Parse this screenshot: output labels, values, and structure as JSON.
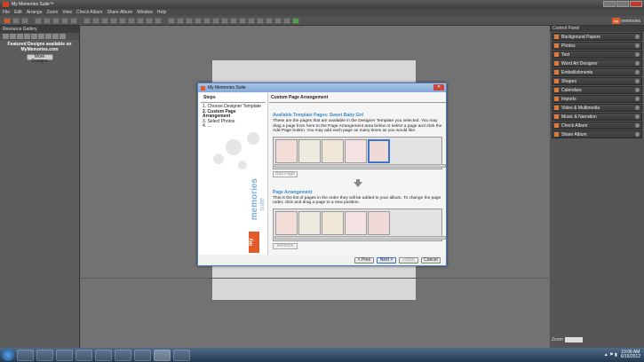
{
  "app": {
    "title": "My Memories Suite™",
    "brand_box": "my",
    "brand_text": "memories"
  },
  "menu": [
    "File",
    "Edit",
    "Arrange",
    "Zoom",
    "View",
    "Check Album",
    "Share Album",
    "Window",
    "Help"
  ],
  "left_panel": {
    "title": "Resource Gallery",
    "message_line1": "Featured Designs available on",
    "message_line2": "MyMemories.com",
    "more_button": "More Designs"
  },
  "right_panel": {
    "title": "Control Panel",
    "items": [
      "Background Papers",
      "Photos",
      "Text",
      "Word Art Designer",
      "Embellishments",
      "Shapes",
      "Calendars",
      "Imports",
      "Video & Multimedia",
      "Music & Narration",
      "Check Album",
      "Share Album"
    ],
    "zoom_label": "Zoom"
  },
  "dialog": {
    "title": "My Memories Suite",
    "steps_header": "Steps",
    "steps": [
      "1. Choose Designer Template",
      "2. Custom Page Arrangement",
      "3. Select Photos",
      "4. ..."
    ],
    "section_header": "Custom Page Arrangement",
    "available_heading": "Available Template Pages: Sweet Baby Girl",
    "available_text": "These are the pages that are available in the Designer Template you selected. You may drag a page from here to the Page Arrangement area below or select a page and click the Add Page button. You may add each page as many times as you would like.",
    "add_page": "Add Page",
    "arrangement_heading": "Page Arrangement",
    "arrangement_text": "This is the list of pages in the order they will be added to your album. To change the page order, click and drag a page to a new position.",
    "remove": "Remove",
    "buttons": {
      "prev": "< Prev",
      "next": "Next >",
      "finish": "Finish",
      "cancel": "Cancel"
    },
    "logo_my": "my",
    "logo_memories": "memories",
    "logo_suite": "suite"
  },
  "taskbar": {
    "time": "10:06 AM",
    "date": "6/15/2012"
  },
  "colors": {
    "accent": "#e05a2a",
    "dialog_heading": "#3a8cc8",
    "selection": "#3a74c8"
  }
}
